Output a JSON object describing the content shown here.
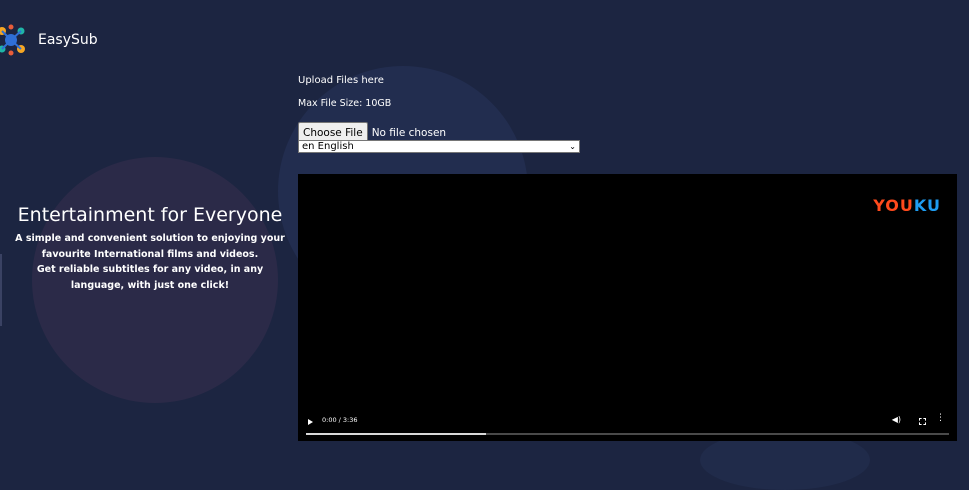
{
  "header": {
    "brand": "EasySub",
    "logo_icon": "easysub-logo-icon"
  },
  "hero": {
    "title": "Entertainment for Everyone",
    "line1": "A simple and convenient solution to enjoying your",
    "line2": "favourite International films and videos.",
    "line3": "Get reliable subtitles for any video, in any",
    "line4": "language, with just one click!"
  },
  "upload": {
    "title": "Upload Files here",
    "max_size": "Max File Size: 10GB",
    "choose_label": "Choose File",
    "file_status": "No file chosen",
    "language_selected": "en English"
  },
  "video": {
    "brand_watermark": [
      "YO",
      "U",
      "K",
      "U"
    ],
    "time": "0:00 / 3:36",
    "progress": 0.28
  },
  "colors": {
    "background": "#1c2541",
    "youku_orange": "#ff4a1c",
    "youku_blue": "#1e9cf0"
  }
}
